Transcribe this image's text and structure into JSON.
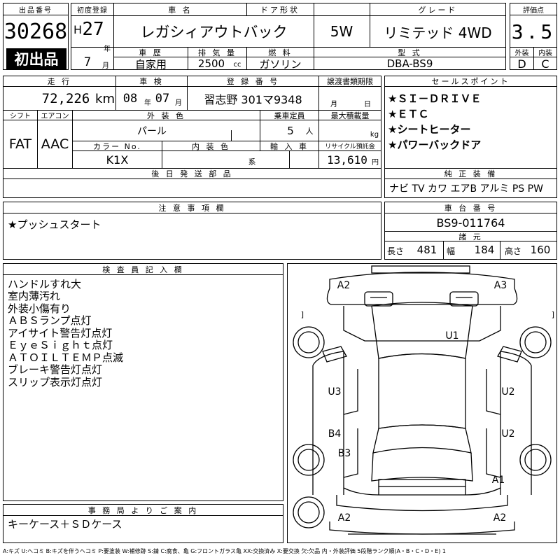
{
  "lot": {
    "label": "出品番号",
    "number": "30268",
    "badge": "初出品"
  },
  "reg": {
    "label": "初度登録",
    "era": "H",
    "year": "27",
    "year_unit": "年",
    "month": "7",
    "month_unit": "月"
  },
  "car": {
    "name_label": "車 名",
    "name": "レガシィアウトバック",
    "history_label": "車 歴",
    "history": "自家用",
    "disp_label": "排 気 量",
    "disp": "2500",
    "disp_unit": "cc"
  },
  "door": {
    "label": "ドア形状",
    "value": "5W"
  },
  "fuel": {
    "label": "燃 料",
    "value": "ガソリン"
  },
  "grade": {
    "label": "グレード",
    "value": "リミテッド 4WD"
  },
  "model": {
    "label": "型 式",
    "value": "DBA-BS9"
  },
  "score": {
    "label": "評価点",
    "value": "3.5",
    "ext_label": "外装",
    "ext": "D",
    "int_label": "内装",
    "int": "C"
  },
  "mileage": {
    "label": "走 行",
    "value": "72,226",
    "unit": "km"
  },
  "inspection": {
    "label": "車 検",
    "year": "08",
    "year_unit": "年",
    "month": "07",
    "month_unit": "月"
  },
  "plate": {
    "label": "登 録 番 号",
    "value": "習志野 301マ9348"
  },
  "transfer": {
    "label": "譲渡書類期限",
    "month_unit": "月",
    "day_unit": "日"
  },
  "shift": {
    "label": "シフト",
    "value": "FAT"
  },
  "aircon": {
    "label": "エアコン",
    "value": "AAC"
  },
  "exterior": {
    "label": "外 装 色",
    "value": "パール",
    "colorno_label": "カラー No.",
    "colorno": "K1X",
    "interior_label": "内 装 色",
    "interior_suffix": "系"
  },
  "capacity": {
    "label": "乗車定員",
    "value": "5",
    "unit": "人",
    "import_label": "輸 入 車"
  },
  "load": {
    "label": "最大積載量",
    "unit": "kg"
  },
  "recycle": {
    "label": "リサイクル預託金",
    "value": "13,610",
    "unit": "円"
  },
  "later_parts": {
    "label": "後 日 発 送 部 品"
  },
  "sales": {
    "label": "セールスポイント",
    "items": [
      "★ＳＩ－ＤＲＩＶＥ",
      "★ＥＴＣ",
      "★シートヒーター",
      "★パワーバックドア"
    ]
  },
  "equip": {
    "label": "純 正 装 備",
    "value": "ナビ TV カワ エアB アルミ PS PW"
  },
  "notes": {
    "label": "注 意 事 項 欄",
    "value": "★プッシュスタート"
  },
  "chassis": {
    "label": "車 台 番 号",
    "value": "BS9-011764"
  },
  "dims": {
    "label": "諸 元",
    "len_label": "長さ",
    "len": "481",
    "wid_label": "幅",
    "wid": "184",
    "hgt_label": "高さ",
    "hgt": "160"
  },
  "inspector": {
    "label": "検 査 員 記 入 欄",
    "lines": [
      "ハンドルすれ大",
      "室内薄汚れ",
      "外装小傷有り",
      "ＡＢＳランプ点灯",
      "アイサイト警告灯点灯",
      "ＥｙｅＳｉｇｈｔ点灯",
      "ＡＴＯＩＬＴＥＭＰ点滅",
      "ブレーキ警告灯点灯",
      "スリップ表示灯点灯"
    ]
  },
  "office": {
    "label": "事 務 局 よ り ご 案 内",
    "value": "キーケース＋ＳＤケース"
  },
  "diagram": {
    "marks": [
      "A2",
      "A3",
      "U1",
      "U3",
      "U2",
      "B4",
      "U2",
      "B3",
      "A1",
      "A2",
      "A2"
    ],
    "bracket_left": "[ ]",
    "bracket_right": "[ ]"
  },
  "legend": "A:キズ U:ヘコミ B:キズを伴うヘコミ P:要塗装 W:補修跡 S:錆 C:腐食、亀 G:フロントガラス亀 XX:交換済み X:要交換 欠:欠品 内・外装評価 5段階ランク順(A・B・C・D・E) 1"
}
